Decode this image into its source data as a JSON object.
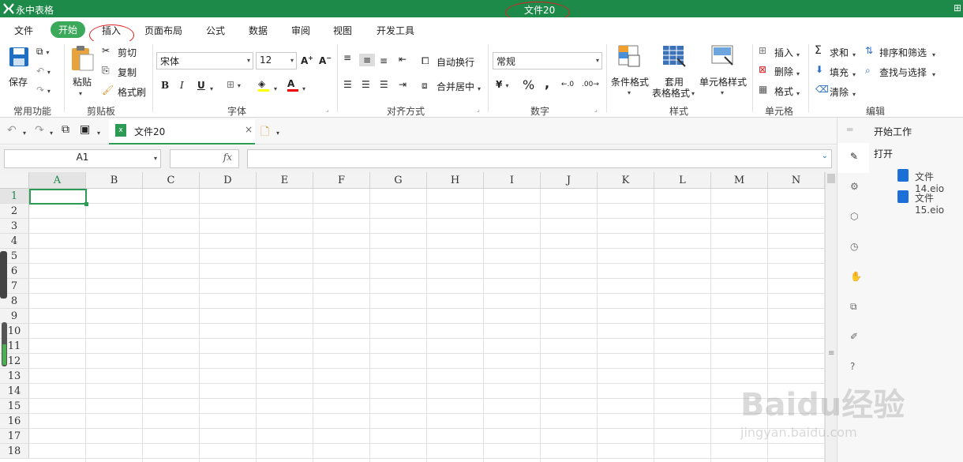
{
  "window": {
    "app_name": "永中表格",
    "doc_title": "文件20"
  },
  "menu": [
    "文件",
    "开始",
    "插入",
    "页面布局",
    "公式",
    "数据",
    "审阅",
    "视图",
    "开发工具"
  ],
  "ribbon": {
    "save": "保存",
    "groups": {
      "common": "常用功能",
      "clipboard": "剪贴板",
      "font": "字体",
      "align": "对齐方式",
      "number": "数字",
      "styles": "样式",
      "cells": "单元格",
      "edit": "编辑"
    },
    "clipboard": {
      "paste": "粘贴",
      "cut": "剪切",
      "copy": "复制",
      "format_painter": "格式刷"
    },
    "font": {
      "name": "宋体",
      "size": "12",
      "bold": "B",
      "italic": "I",
      "underline": "U",
      "color_letter": "A"
    },
    "align": {
      "wrap": "自动换行",
      "merge": "合并居中"
    },
    "number": {
      "format": "常规",
      "currency": "¥",
      "percent": "%",
      "comma": ","
    },
    "styles": {
      "cond": "条件格式",
      "table1": "套用",
      "table2": "表格格式",
      "cell": "单元格样式"
    },
    "cells": {
      "insert": "插入",
      "delete": "删除",
      "format": "格式"
    },
    "edit": {
      "sum": "求和",
      "sort": "排序和筛选",
      "fill": "填充",
      "find": "查找与选择",
      "clear": "清除"
    }
  },
  "tab": {
    "name": "文件20"
  },
  "formula": {
    "cell_ref": "A1",
    "fx": "fx",
    "content": ""
  },
  "columns": [
    "A",
    "B",
    "C",
    "D",
    "E",
    "F",
    "G",
    "H",
    "I",
    "J",
    "K",
    "L",
    "M",
    "N"
  ],
  "rows": [
    "1",
    "2",
    "3",
    "4",
    "5",
    "6",
    "7",
    "8",
    "9",
    "10",
    "11",
    "12",
    "13",
    "14",
    "15",
    "16",
    "17",
    "18"
  ],
  "taskpane": {
    "title": "开始工作",
    "open": "打开",
    "files": [
      "文件14.eio",
      "文件15.eio"
    ]
  },
  "watermark": {
    "brand": "Baidu经验",
    "url": "jingyan.baidu.com"
  }
}
